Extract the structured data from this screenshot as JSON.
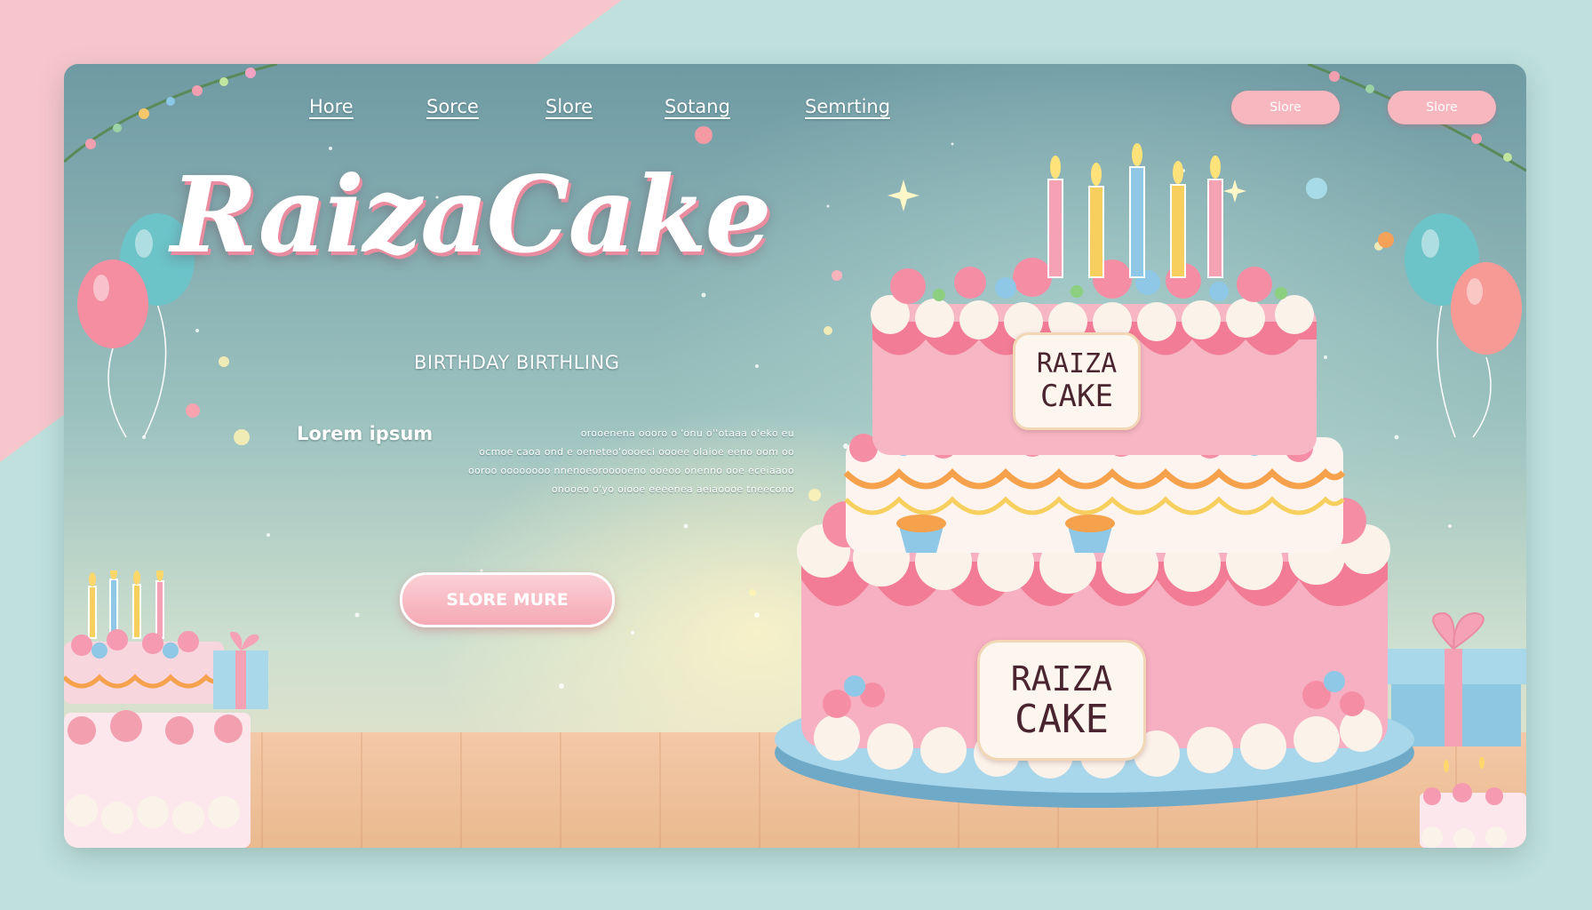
{
  "nav": {
    "items": [
      {
        "label": "Hore"
      },
      {
        "label": "Sorce"
      },
      {
        "label": "Slore"
      },
      {
        "label": "Sotang"
      },
      {
        "label": "Semrting"
      }
    ],
    "right_buttons": [
      {
        "label": "Slore"
      },
      {
        "label": "Slore"
      }
    ]
  },
  "hero": {
    "brand": "RaizaCake",
    "subtitle": "BIRTHDAY BIRTHLING",
    "lorem_heading": "Lorem ipsum",
    "lorem_lines": [
      "orooenena oooro o 'onu o''otaaa o'eko eu",
      "ocmoe caoa ond e oeneteo'oooeci oooee olaioe eeno oom oo",
      "ooroo oooooooo nnenoeorooooeno ooeoo onenno ooe eceiaaoo",
      "onooeo o'yo oiooe eeeenea aeiaoooe tneecono"
    ],
    "cta_label": "SLORE MURE"
  },
  "cake": {
    "top_plaque": [
      "RAIZA",
      "CAKE"
    ],
    "bottom_plaque": [
      "RAIZA",
      "CAKE"
    ]
  },
  "colors": {
    "accent_pink": "#f5a9b4",
    "cake_pink": "#f7b6c4",
    "cream": "#fbf2ea",
    "plate_blue": "#8fc8de",
    "title_shadow": "#e98ca0"
  }
}
